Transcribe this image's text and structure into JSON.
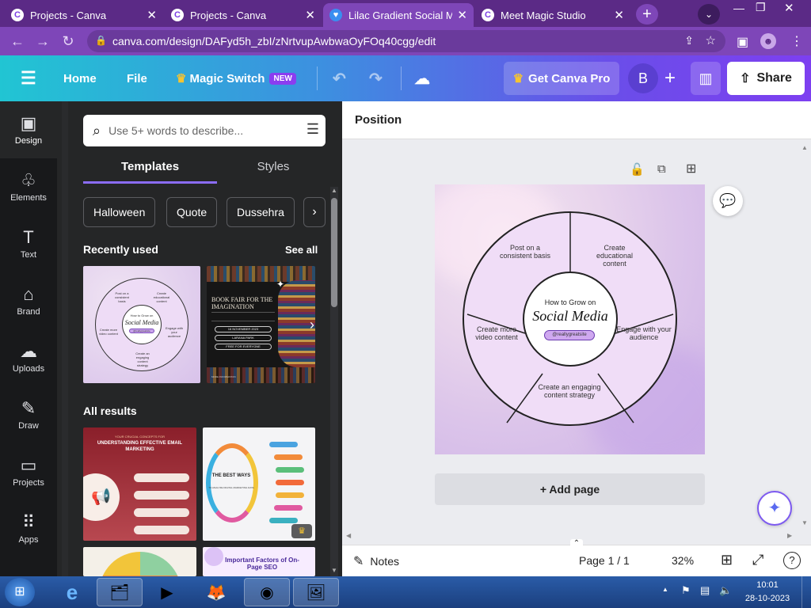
{
  "browser": {
    "tabs": [
      {
        "title": "Projects - Canva",
        "active": false
      },
      {
        "title": "Projects - Canva",
        "active": false
      },
      {
        "title": "Lilac Gradient Social Me",
        "active": true
      },
      {
        "title": "Meet Magic Studio",
        "active": false
      }
    ],
    "url": "canva.com/design/DAFyd5h_zbI/zNrtvupAwbwaOyFOq40cgg/edit"
  },
  "toolbar": {
    "home": "Home",
    "file": "File",
    "magic_switch": "Magic Switch",
    "new_badge": "NEW",
    "get_pro": "Get Canva Pro",
    "avatar_initial": "B",
    "share": "Share"
  },
  "sidebar": {
    "items": [
      {
        "label": "Design",
        "icon": "design-icon",
        "glyph": "▣"
      },
      {
        "label": "Elements",
        "icon": "elements-icon",
        "glyph": "♧"
      },
      {
        "label": "Text",
        "icon": "text-icon",
        "glyph": "T"
      },
      {
        "label": "Brand",
        "icon": "brand-icon",
        "glyph": "⌂"
      },
      {
        "label": "Uploads",
        "icon": "uploads-icon",
        "glyph": "☁"
      },
      {
        "label": "Draw",
        "icon": "draw-icon",
        "glyph": "✎"
      },
      {
        "label": "Projects",
        "icon": "projects-icon",
        "glyph": "▭"
      },
      {
        "label": "Apps",
        "icon": "apps-icon",
        "glyph": "⠿"
      }
    ]
  },
  "panel": {
    "search_placeholder": "Use 5+ words to describe...",
    "tabs": [
      "Templates",
      "Styles"
    ],
    "chips": [
      "Halloween",
      "Quote",
      "Dussehra"
    ],
    "recently_used": "Recently used",
    "see_all": "See all",
    "all_results": "All results",
    "thumb1": {
      "title_small": "How to Grow on",
      "title_big": "Social Media",
      "handle": "@reallygreatsite",
      "segments": [
        "Post on a consistent basis",
        "Create educational content",
        "Engage with your audience",
        "Create an engaging content strategy",
        "Create more video content"
      ]
    },
    "thumb2": {
      "title": "BOOK FAIR FOR THE IMAGINATION",
      "date": "16 NOVEMBER 2023",
      "place": "LARANA PARK",
      "free": "FREE FOR EVERYONE",
      "more": "MORE INFORMATION"
    },
    "result1": {
      "kicker": "YOUR CRUCIAL CONCEPTS FOR",
      "title": "UNDERSTANDING EFFECTIVE EMAIL MARKETING"
    },
    "result2": {
      "title": "THE BEST WAYS",
      "subtitle": "TO ANALYZE DIGITAL MARKETING DATA"
    },
    "result4": {
      "title": "Important Factors of On-Page SEO"
    }
  },
  "canvas": {
    "position_label": "Position",
    "design": {
      "title_small": "How to Grow on",
      "title_big": "Social Media",
      "handle": "@reallygreatsite",
      "segments": [
        "Post on a consistent basis",
        "Create educational content",
        "Engage with your audience",
        "Create an engaging content strategy",
        "Create more video content"
      ]
    },
    "add_page": "+ Add page"
  },
  "status": {
    "notes": "Notes",
    "page_counter": "Page 1 / 1",
    "zoom": "32%"
  },
  "taskbar": {
    "time": "10:01",
    "date": "28-10-2023"
  },
  "colors": {
    "tabbar": "#5b2a86",
    "toolbar_start": "#21c5d3",
    "toolbar_end": "#7d3ff0",
    "sidebar": "#18191b",
    "panel": "#252627",
    "accent_purple": "#8b3df0"
  }
}
